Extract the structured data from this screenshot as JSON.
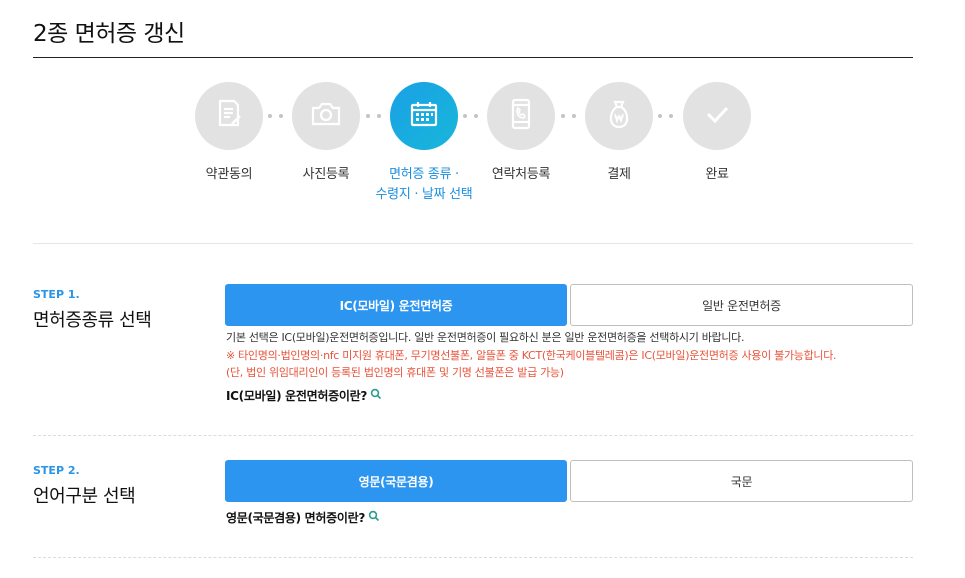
{
  "page": {
    "title": "2종 면허증 갱신"
  },
  "steps": [
    {
      "label_line1": "약관동의",
      "label_line2": "",
      "icon": "document-icon",
      "active": false
    },
    {
      "label_line1": "사진등록",
      "label_line2": "",
      "icon": "camera-icon",
      "active": false
    },
    {
      "label_line1": "면허증 종류 ·",
      "label_line2": "수령지 · 날짜 선택",
      "icon": "calendar-icon",
      "active": true
    },
    {
      "label_line1": "연락처등록",
      "label_line2": "",
      "icon": "phone-icon",
      "active": false
    },
    {
      "label_line1": "결제",
      "label_line2": "",
      "icon": "money-bag-icon",
      "active": false
    },
    {
      "label_line1": "완료",
      "label_line2": "",
      "icon": "check-icon",
      "active": false
    }
  ],
  "section1": {
    "step_no": "STEP 1.",
    "title": "면허증종류 선택",
    "option_selected": "IC(모바일) 운전면허증",
    "option_other": "일반 운전면허증",
    "desc": "기본 선택은 IC(모바일)운전면허증입니다. 일반 운전면허증이 필요하신 분은 일반 운전면허증을 선택하시기 바랍니다.",
    "warn1": "※ 타인명의·법인명의·nfc 미지원 휴대폰, 무기명선불폰, 알뜰폰 중 KCT(한국케이블텔레콤)은 IC(모바일)운전면허증 사용이 불가능합니다.",
    "warn2": "(단, 법인 위임대리인이 등록된 법인명의 휴대폰 및 기명 선불폰은 발급 가능)",
    "help_link": "IC(모바일) 운전면허증이란?"
  },
  "section2": {
    "step_no": "STEP 2.",
    "title": "언어구분 선택",
    "option_selected": "영문(국문겸용)",
    "option_other": "국문",
    "help_link": "영문(국문겸용) 면허증이란?"
  },
  "colors": {
    "accent": "#2b95f0",
    "active_step": "#1aa0e6",
    "warning": "#e8533b",
    "inactive_step": "#e2e2e2"
  }
}
